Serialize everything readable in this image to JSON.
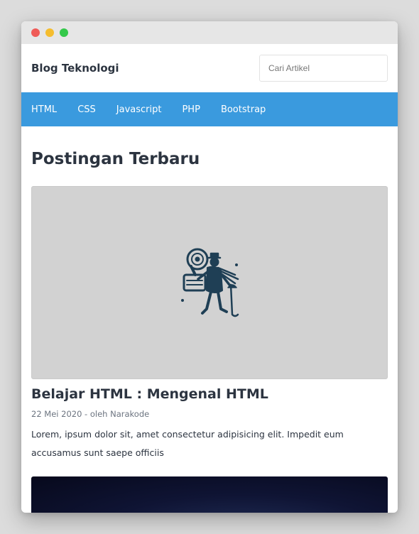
{
  "brand": {
    "title": "Blog Teknologi"
  },
  "search": {
    "placeholder": "Cari Artikel",
    "value": ""
  },
  "nav": {
    "items": [
      {
        "label": "HTML"
      },
      {
        "label": "CSS"
      },
      {
        "label": "Javascript"
      },
      {
        "label": "PHP"
      },
      {
        "label": "Bootstrap"
      }
    ]
  },
  "main": {
    "section_title": "Postingan Terbaru",
    "posts": [
      {
        "title": "Belajar HTML : Mengenal HTML",
        "meta": "22 Mei 2020 - oleh Narakode",
        "excerpt": "Lorem, ipsum dolor sit, amet consectetur adipisicing elit. Impedit eum accusamus sunt saepe officiis",
        "image_icon": "explorer-illustration-icon"
      }
    ]
  },
  "colors": {
    "navbar": "#3a9ade",
    "text": "#2c3440",
    "image_placeholder": "#d2d2d2"
  }
}
